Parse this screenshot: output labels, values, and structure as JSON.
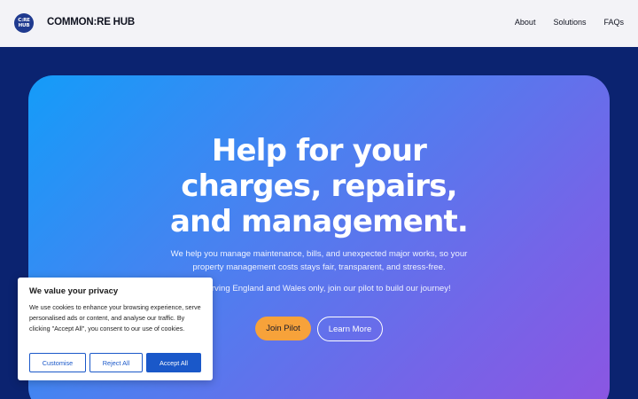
{
  "header": {
    "logo_line1": "C:RE",
    "logo_line2": "HUB",
    "brand": "COMMON:RE HUB",
    "nav": [
      "About",
      "Solutions",
      "FAQs"
    ]
  },
  "hero": {
    "title_line1": "Help for your",
    "title_line2": "charges, repairs,",
    "title_line3": "and management.",
    "subtitle": "We help you manage maintenance, bills, and unexpected major works, so your property management costs stays fair, transparent, and stress-free.",
    "pilot_note": "y serving England and Wales only, join our pilot to build our journey!",
    "join_button": "Join Pilot",
    "learn_button": "Learn More"
  },
  "cookie_banner": {
    "title": "We value your privacy",
    "text": "We use cookies to enhance your browsing experience, serve personalised ads or content, and analyse our traffic. By clicking \"Accept All\", you consent to our use of cookies.",
    "customise": "Customise",
    "reject": "Reject All",
    "accept": "Accept All"
  },
  "colors": {
    "header_bg": "#f3f3f7",
    "page_bg": "#0b2370",
    "hero_gradient_start": "#149cf9",
    "hero_gradient_end": "#8c55e2",
    "join_button": "#f7a23a",
    "cookie_accent": "#1a58c9"
  }
}
